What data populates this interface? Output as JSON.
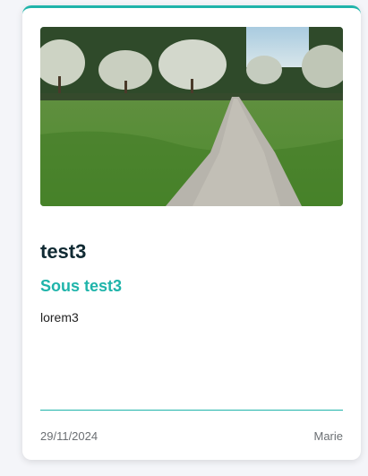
{
  "card": {
    "image_alt": "path-through-orchard-image",
    "title": "test3",
    "subtitle": "Sous test3",
    "body": "lorem3",
    "date": "29/11/2024",
    "author": "Marie"
  },
  "colors": {
    "accent": "#1fb4aa",
    "title": "#102a33",
    "background": "#f4f5f9"
  }
}
